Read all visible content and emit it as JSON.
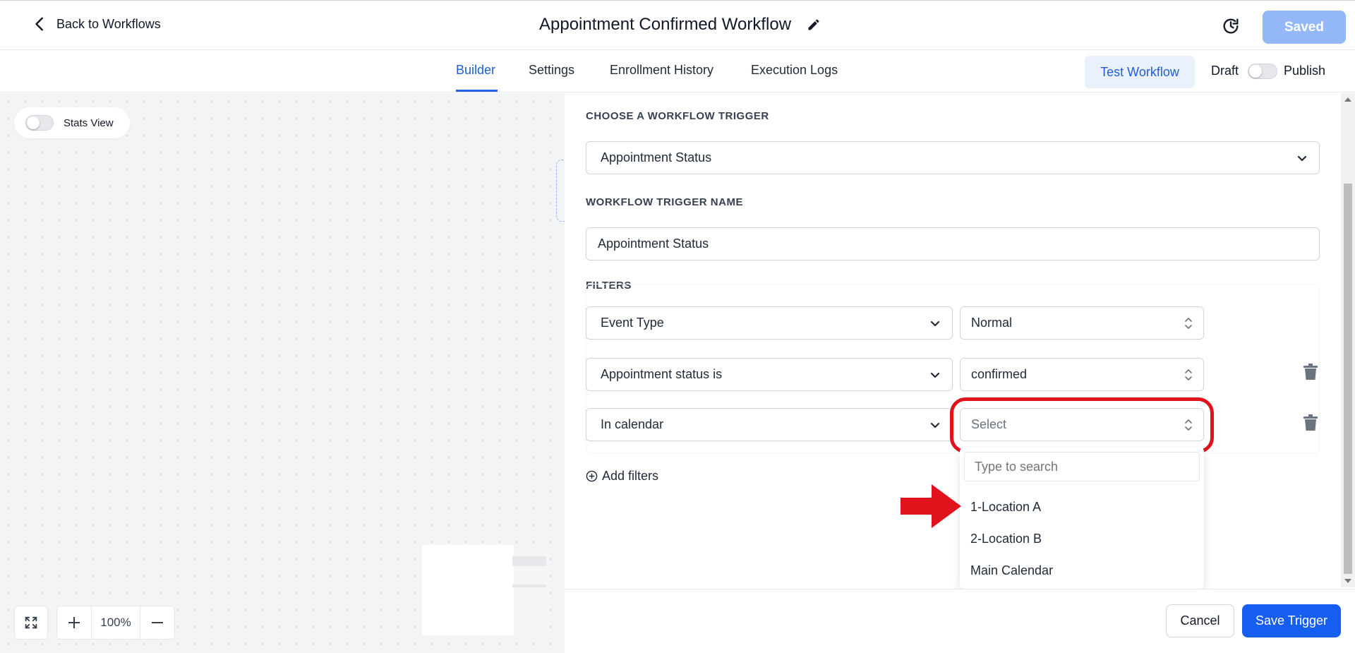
{
  "header": {
    "back_label": "Back to Workflows",
    "title": "Appointment Confirmed Workflow",
    "saved_label": "Saved"
  },
  "tabs": [
    {
      "label": "Builder",
      "active": true
    },
    {
      "label": "Settings",
      "active": false
    },
    {
      "label": "Enrollment History",
      "active": false
    },
    {
      "label": "Execution Logs",
      "active": false
    }
  ],
  "toolbar": {
    "test_label": "Test Workflow",
    "draft_label": "Draft",
    "publish_label": "Publish",
    "published": false
  },
  "canvas": {
    "stats_label": "Stats View",
    "stats_on": false,
    "zoom": "100%"
  },
  "trigger": {
    "choose_label": "CHOOSE A WORKFLOW TRIGGER",
    "trigger_value": "Appointment Status",
    "name_label": "WORKFLOW TRIGGER NAME",
    "name_value": "Appointment Status"
  },
  "filters": {
    "label": "FILTERS",
    "rows": [
      {
        "field": "Event Type",
        "value": "Normal"
      },
      {
        "field": "Appointment status is",
        "value": "confirmed"
      },
      {
        "field": "In calendar",
        "placeholder": "Select"
      }
    ],
    "add_label": "Add filters"
  },
  "dropdown": {
    "search_placeholder": "Type to search",
    "options": [
      "1-Location A",
      "2-Location B",
      "Main Calendar"
    ]
  },
  "footer": {
    "cancel_label": "Cancel",
    "save_label": "Save Trigger"
  },
  "colors": {
    "accent": "#155eef",
    "highlight": "#e0121c"
  }
}
